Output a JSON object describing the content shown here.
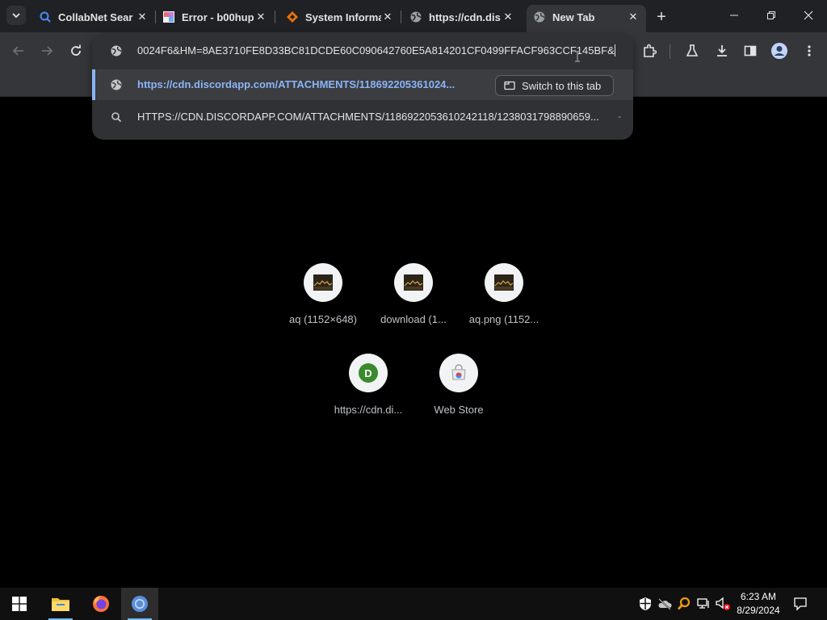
{
  "tabs": [
    {
      "title": "CollabNet Sear",
      "icon": "search-icon",
      "color": "#4c8bf5"
    },
    {
      "title": "Error - b00hup",
      "icon": "image-icon",
      "color": "#e06c75"
    },
    {
      "title": "System Informa",
      "icon": "diamond-icon",
      "color": "#e8710a"
    },
    {
      "title": "https://cdn.dis",
      "icon": "globe-icon",
      "color": "#9aa0a6"
    },
    {
      "title": "New Tab",
      "icon": "globe-icon",
      "color": "#9aa0a6"
    }
  ],
  "omnibox": {
    "input_text": "0024F6&HM=8AE3710FE8D33BC81DCDE60C090642760E5A814201CF0499FFACF963CCF145BF&",
    "suggestions": [
      {
        "text": "https://cdn.discordapp.com/ATTACHMENTS/118692205361024...",
        "action": "Switch to this tab",
        "icon": "globe-icon"
      },
      {
        "text": "HTTPS://CDN.DISCORDAPP.COM/ATTACHMENTS/1186922053610242118/1238031798890659...",
        "trail": "-",
        "icon": "search-icon"
      }
    ]
  },
  "shortcuts": [
    {
      "label": "aq (1152×648)",
      "icon": "image-thumbnail-icon"
    },
    {
      "label": "download (1...",
      "icon": "image-thumbnail-icon"
    },
    {
      "label": "aq.png (1152...",
      "icon": "image-thumbnail-icon"
    },
    {
      "label": "https://cdn.di...",
      "icon": "letter-d-icon",
      "letter": "D"
    },
    {
      "label": "Web Store",
      "icon": "web-store-icon"
    }
  ],
  "taskbar": {
    "time": "6:23 AM",
    "date": "8/29/2024",
    "apps": [
      "file-explorer-icon",
      "firefox-icon",
      "chrome-icon"
    ]
  },
  "colors": {
    "accent": "#8ab4f8",
    "background": "#000000",
    "toolbar": "#35363a",
    "tabstrip": "#202124"
  }
}
